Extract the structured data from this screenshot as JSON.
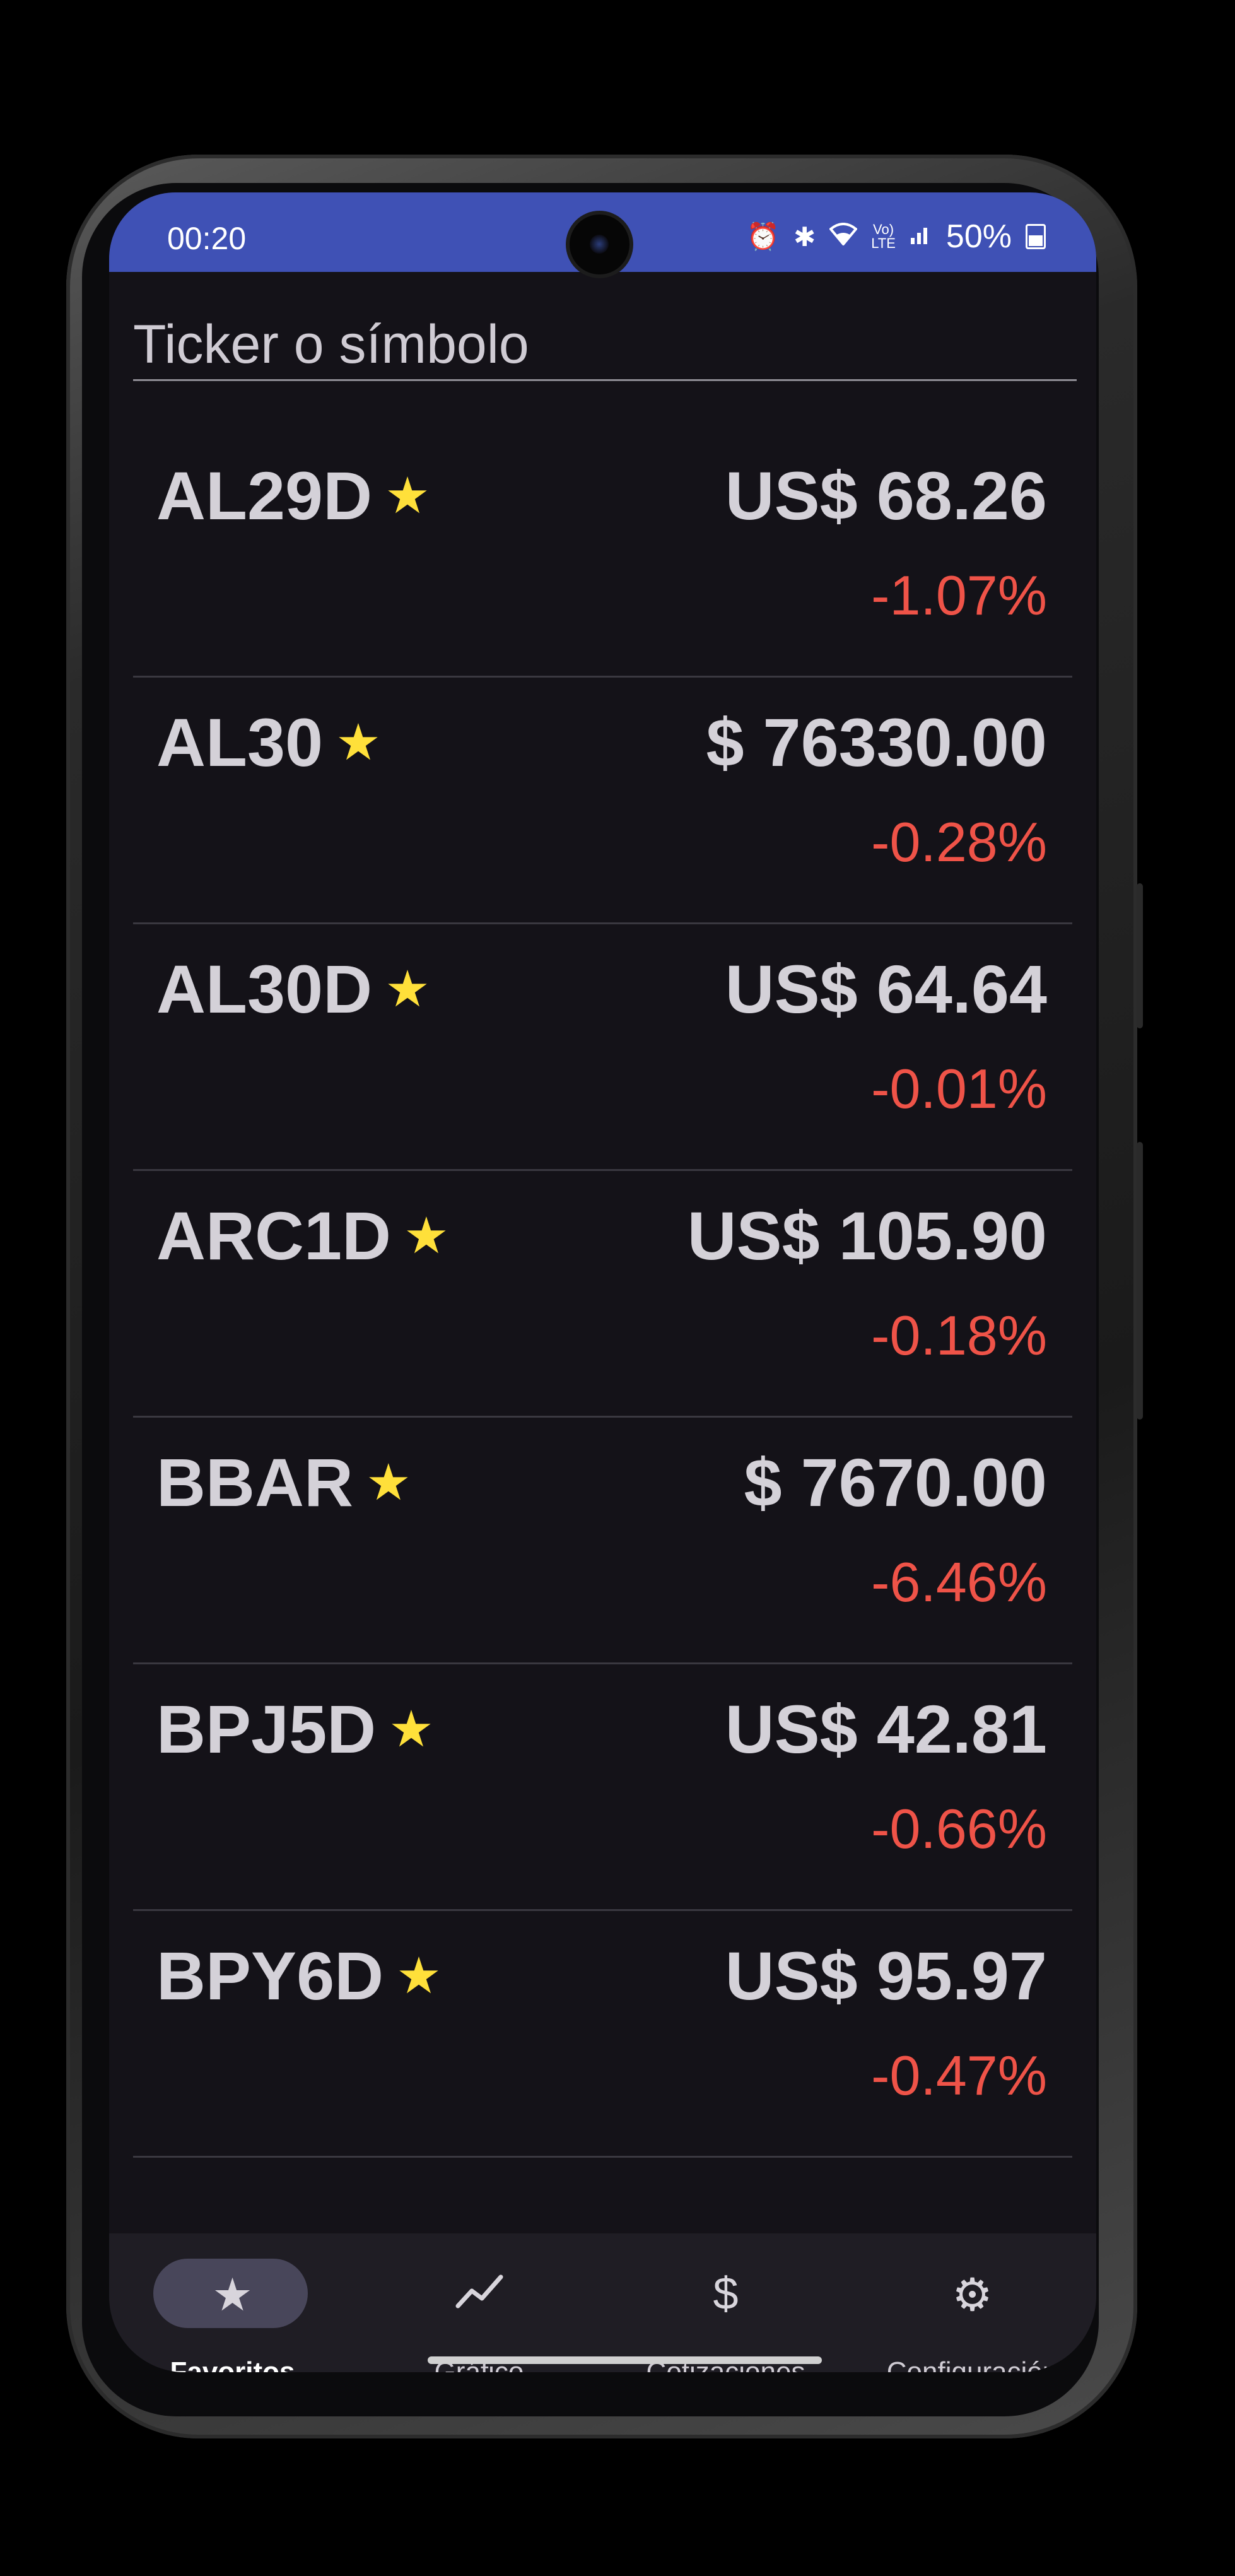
{
  "status_bar": {
    "time": "00:20",
    "battery": "50%",
    "icons": [
      "alarm-icon",
      "bluetooth-icon",
      "wifi-icon",
      "volte-icon",
      "signal-icon",
      "battery-icon"
    ]
  },
  "search": {
    "placeholder": "Ticker o símbolo"
  },
  "tickers": [
    {
      "symbol": "AL29D",
      "price": "US$ 68.26",
      "change": "-1.07%"
    },
    {
      "symbol": "AL30",
      "price": "$ 76330.00",
      "change": "-0.28%"
    },
    {
      "symbol": "AL30D",
      "price": "US$ 64.64",
      "change": "-0.01%"
    },
    {
      "symbol": "ARC1D",
      "price": "US$ 105.90",
      "change": "-0.18%"
    },
    {
      "symbol": "BBAR",
      "price": "$ 7670.00",
      "change": "-6.46%"
    },
    {
      "symbol": "BPJ5D",
      "price": "US$ 42.81",
      "change": "-0.66%"
    },
    {
      "symbol": "BPY6D",
      "price": "US$ 95.97",
      "change": "-0.47%"
    }
  ],
  "nav": {
    "items": [
      {
        "label": "Favoritos",
        "icon": "star-icon",
        "active": true
      },
      {
        "label": "Gráfico",
        "icon": "chart-icon",
        "active": false
      },
      {
        "label": "Cotizaciones",
        "icon": "dollar-icon",
        "active": false
      },
      {
        "label": "Configuración",
        "icon": "gear-icon",
        "active": false
      }
    ]
  },
  "colors": {
    "status_bar": "#3f51b5",
    "background": "#141218",
    "negative_change": "#ef5348",
    "favorite_star": "#ffe03a"
  }
}
